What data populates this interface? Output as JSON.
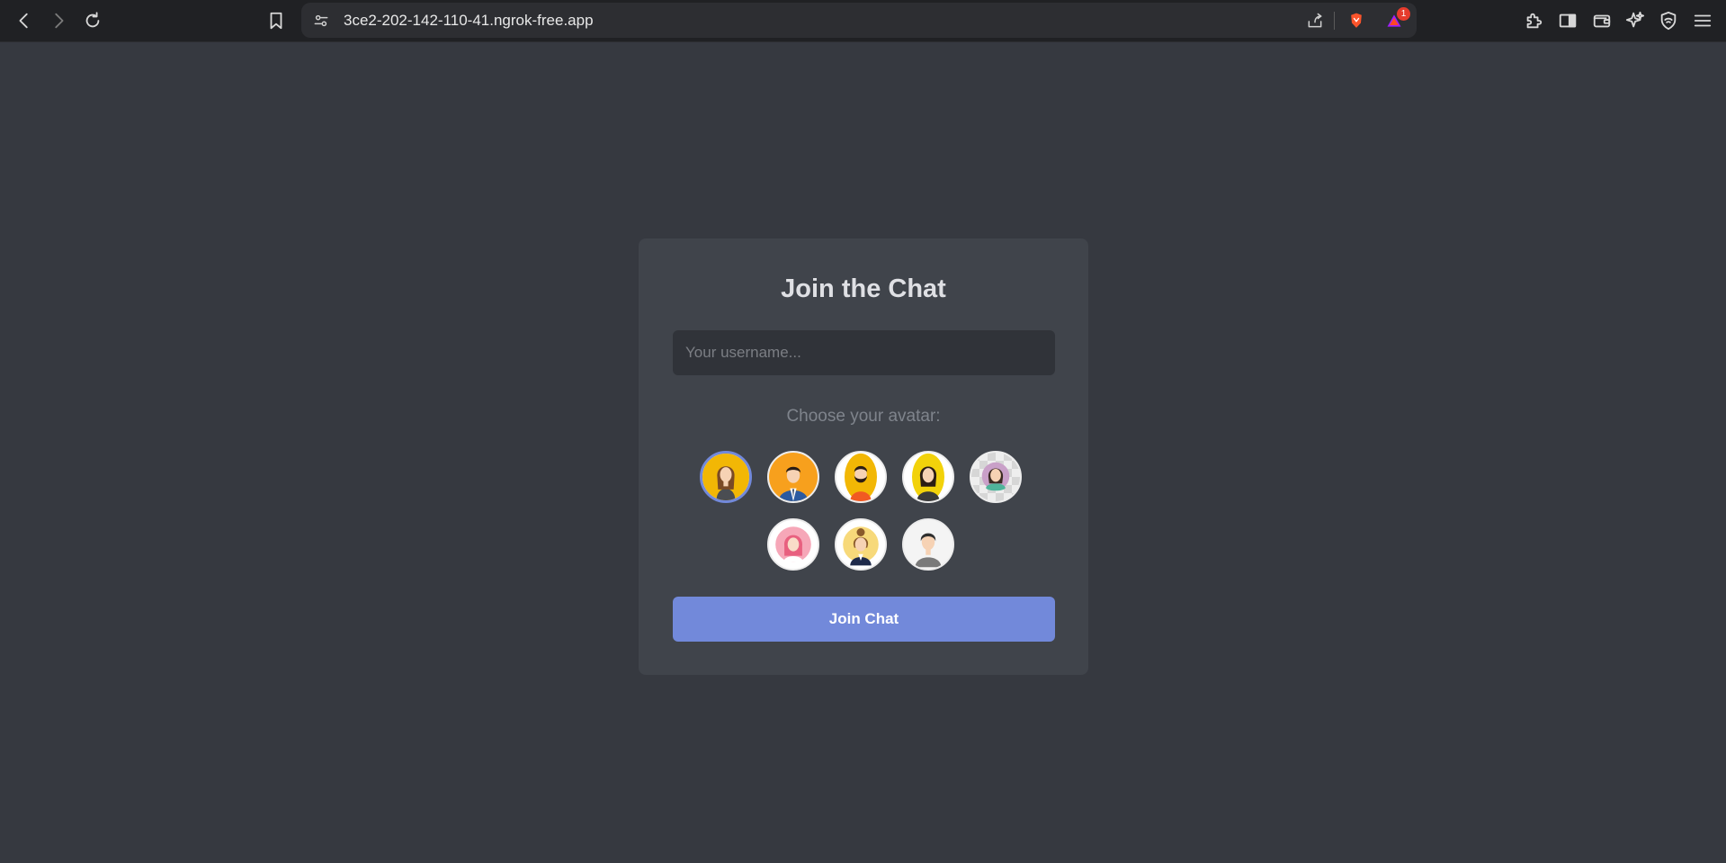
{
  "browser": {
    "url": "3ce2-202-142-110-41.ngrok-free.app",
    "notification_count": "1",
    "nav": {
      "back_icon": "chevron-left-icon",
      "forward_icon": "chevron-right-icon",
      "reload_icon": "reload-icon",
      "bookmark_icon": "bookmark-icon"
    },
    "right_icons": [
      "extensions-icon",
      "sidebar-icon",
      "wallet-icon",
      "leo-ai-icon",
      "vpn-icon",
      "menu-icon"
    ]
  },
  "login": {
    "title": "Join the Chat",
    "username_placeholder": "Your username...",
    "username_value": "",
    "avatar_label": "Choose your avatar:",
    "join_label": "Join Chat",
    "selected_avatar_index": 0,
    "avatars": [
      {
        "name": "avatar-woman-long-hair",
        "bg": "#f2b705"
      },
      {
        "name": "avatar-man-suit",
        "bg": "#f7a01d"
      },
      {
        "name": "avatar-man-beard",
        "bg": "#f2b705"
      },
      {
        "name": "avatar-woman-dark-hair",
        "bg": "#f2d20a"
      },
      {
        "name": "avatar-woman-purple",
        "bg": "#c9a0c8"
      },
      {
        "name": "avatar-woman-pink-hair",
        "bg": "#f6a7b8"
      },
      {
        "name": "avatar-woman-bun",
        "bg": "#f7d97a"
      },
      {
        "name": "avatar-man-gray",
        "bg": "#eeeeee"
      }
    ]
  },
  "colors": {
    "page_bg": "#363940",
    "card_bg": "#40444b",
    "accent": "#7289da"
  }
}
